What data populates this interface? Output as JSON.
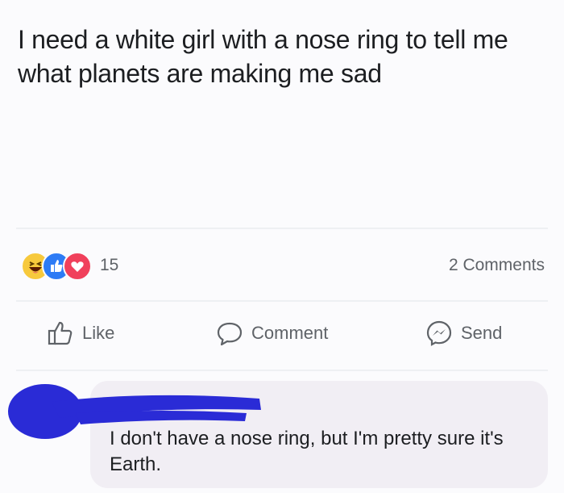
{
  "post": {
    "text": "I need a white girl with a nose ring to tell me what planets are making me sad"
  },
  "stats": {
    "reaction_count": "15",
    "comments_count": "2 Comments",
    "reactions": [
      "haha",
      "like",
      "love"
    ]
  },
  "actions": {
    "like_label": "Like",
    "comment_label": "Comment",
    "send_label": "Send"
  },
  "comment": {
    "text": "I don't have a nose ring, but I'm pretty sure it's Earth."
  },
  "colors": {
    "like_blue": "#2d7bf5",
    "love_red": "#f0405b",
    "haha_yellow": "#f7c93c",
    "redaction_blue": "#2a2bd6",
    "bubble_pink": "#f1eef4"
  }
}
